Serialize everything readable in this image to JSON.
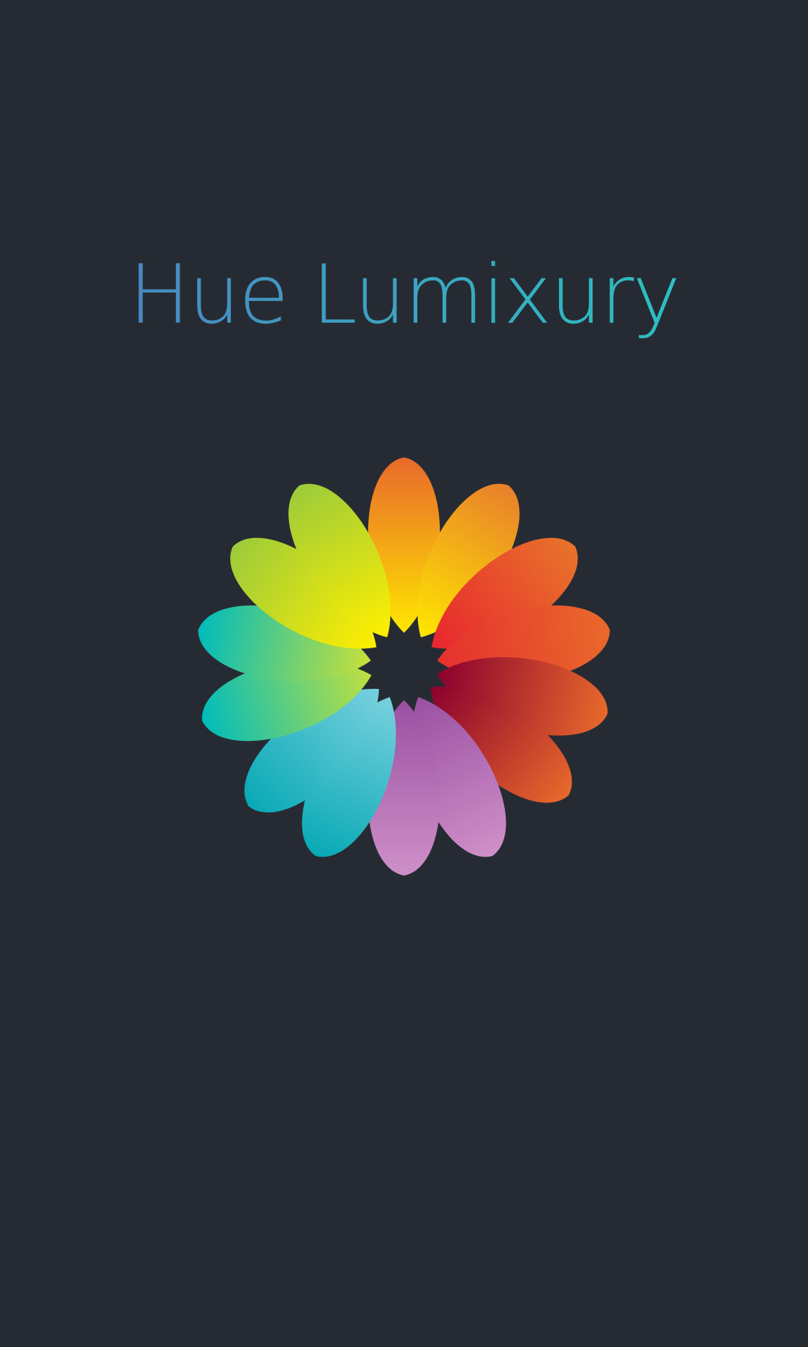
{
  "splash": {
    "app_title": "Hue Lumixury",
    "title_gradient": [
      "#4a88c2",
      "#2cc0c0"
    ],
    "logo": {
      "icon": "flower-logo-icon",
      "petals": [
        {
          "name": "petal-orange",
          "c1": "#e8692b",
          "c2": "#ffe600"
        },
        {
          "name": "petal-orange-yellow",
          "c1": "#e8802b",
          "c2": "#ffe600"
        },
        {
          "name": "petal-orange-red-1",
          "c1": "#e8732b",
          "c2": "#e8262e"
        },
        {
          "name": "petal-orange-red-2",
          "c1": "#e8692b",
          "c2": "#e6302e"
        },
        {
          "name": "petal-crimson-orange-1",
          "c1": "#e8692b",
          "c2": "#8a002e"
        },
        {
          "name": "petal-crimson-orange-2",
          "c1": "#e8692b",
          "c2": "#8a002e"
        },
        {
          "name": "petal-violet-1",
          "c1": "#cf90c8",
          "c2": "#9a50a2"
        },
        {
          "name": "petal-violet-2",
          "c1": "#cf90c8",
          "c2": "#9a50a2"
        },
        {
          "name": "petal-teal-1",
          "c1": "#08a9b5",
          "c2": "#78d0de"
        },
        {
          "name": "petal-teal-2",
          "c1": "#08a9b5",
          "c2": "#78d0de"
        },
        {
          "name": "petal-cyan-green",
          "c1": "#00bcbc",
          "c2": "#c0e040"
        },
        {
          "name": "petal-teal-green",
          "c1": "#00bcbc",
          "c2": "#c8e03a"
        },
        {
          "name": "petal-lime-1",
          "c1": "#9ccb3a",
          "c2": "#ffef00"
        },
        {
          "name": "petal-lime-2",
          "c1": "#9ccb3a",
          "c2": "#ffef00"
        }
      ]
    }
  }
}
